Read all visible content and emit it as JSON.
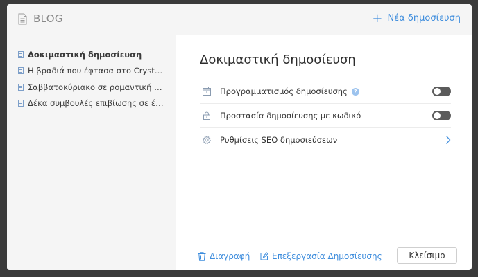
{
  "header": {
    "title": "BLOG",
    "new_post_label": "Νέα δημοσίευση"
  },
  "sidebar": {
    "items": [
      {
        "label": "Δοκιμαστική δημοσίευση",
        "active": true
      },
      {
        "label": "Η βραδιά που έφτασα στο Crystal Palace",
        "active": false
      },
      {
        "label": "Σαββατοκύριακο σε ρομαντική καλύβα",
        "active": false
      },
      {
        "label": "Δέκα συμβουλές επιβίωσης σε ένα ταξίδι",
        "active": false
      }
    ]
  },
  "main": {
    "post_title": "Δοκιμαστική δημοσίευση",
    "settings": {
      "schedule_label": "Προγραμματισμός δημοσίευσης",
      "schedule_help": "?",
      "schedule_enabled": false,
      "password_label": "Προστασία δημοσίευσης με κωδικό",
      "password_enabled": false,
      "seo_label": "Ρυθμίσεις SEO δημοσιεύσεων"
    }
  },
  "footer": {
    "delete_label": "Διαγραφή",
    "edit_label": "Επεξεργασία Δημοσίευσης",
    "close_label": "Κλείσιμο"
  },
  "colors": {
    "accent": "#3e8ddd",
    "toggle_off": "#5b5b5b"
  }
}
